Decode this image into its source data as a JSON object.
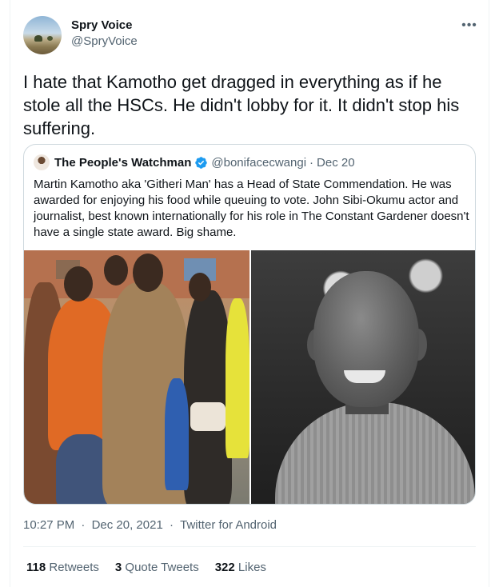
{
  "author": {
    "name": "Spry Voice",
    "handle": "@SpryVoice"
  },
  "more_icon": "more-horizontal-icon",
  "tweet": {
    "text": "I hate that Kamotho get dragged in everything as if he stole all the HSCs. He didn't lobby for it. It didn't stop his suffering."
  },
  "quoted": {
    "name": "The People's Watchman",
    "verified_icon": "verified-badge-icon",
    "handle": "@bonifacecwangi",
    "separator": "·",
    "date": "Dec 20",
    "text": "Martin Kamotho aka 'Githeri Man' has a Head of State Commendation. He was awarded for enjoying his food while queuing to vote. John Sibi-Okumu actor and journalist, best known internationally for his role in The Constant Gardener doesn't have a single state award. Big shame."
  },
  "meta": {
    "time": "10:27 PM",
    "sep1": "·",
    "date": "Dec 20, 2021",
    "sep2": "·",
    "source": "Twitter for Android"
  },
  "stats": {
    "retweets": {
      "count": "118",
      "label": "Retweets"
    },
    "quotes": {
      "count": "3",
      "label": "Quote Tweets"
    },
    "likes": {
      "count": "322",
      "label": "Likes"
    }
  },
  "colors": {
    "text_primary": "#0f1419",
    "text_secondary": "#536471",
    "border": "#cfd9de",
    "verified": "#1d9bf0"
  }
}
